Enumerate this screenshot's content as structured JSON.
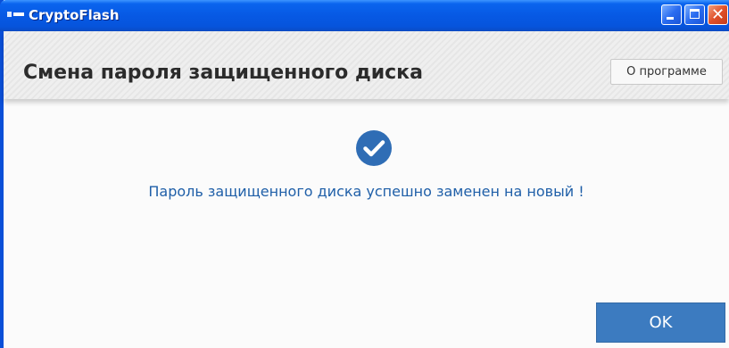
{
  "window": {
    "title": "CryptoFlash"
  },
  "header": {
    "title": "Смена пароля защищенного диска",
    "about_label": "О программе"
  },
  "content": {
    "status_icon": "check-circle-icon",
    "message": "Пароль защищенного диска успешно заменен на новый !"
  },
  "footer": {
    "ok_label": "OK"
  },
  "colors": {
    "titlebar": "#0759e4",
    "message_text": "#1f5fa8",
    "ok_button": "#3c7bc0",
    "check_icon": "#2f6db5"
  }
}
